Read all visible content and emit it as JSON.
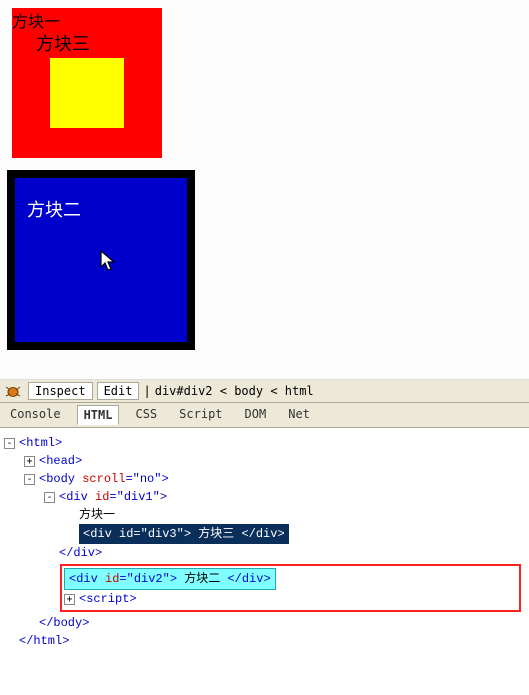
{
  "preview": {
    "box1_label": "方块一",
    "box2_label": "方块二",
    "box3_label": "方块三"
  },
  "toolbar": {
    "inspect": "Inspect",
    "edit": "Edit",
    "breadcrumb": "div#div2 < body < html"
  },
  "tabs": {
    "console": "Console",
    "html": "HTML",
    "css": "CSS",
    "script": "Script",
    "dom": "DOM",
    "net": "Net"
  },
  "tree": {
    "html_open": "<html>",
    "head": "<head>",
    "body_open": "<body ",
    "body_attr_name": "scroll",
    "body_attr_val": "\"no\"",
    "body_close_bracket": ">",
    "div1_open": "<div ",
    "div1_attr_name": "id",
    "div1_attr_val": "\"div1\"",
    "div1_close_bracket": ">",
    "div1_text": "方块一",
    "div3_open": "<div ",
    "div3_attr_name": "id",
    "div3_attr_val": "\"div3\"",
    "div3_text": " 方块三 ",
    "div3_close": "</div>",
    "div1_end": "</div>",
    "div2_open": "<div ",
    "div2_attr_name": "id",
    "div2_attr_val": "\"div2\"",
    "div2_text": " 方块二 ",
    "div2_close": "</div>",
    "script_node": "<script>",
    "body_end": "</body>",
    "html_end": "</html>"
  }
}
